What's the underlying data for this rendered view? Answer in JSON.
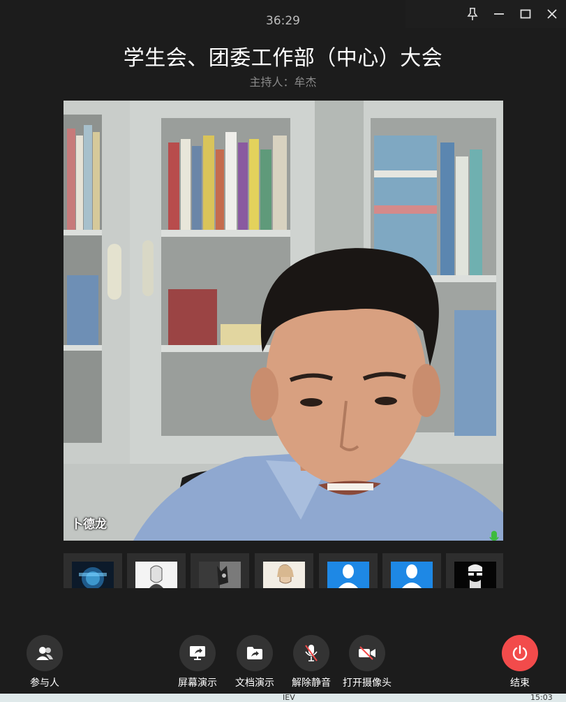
{
  "meeting": {
    "timer": "36:29",
    "title": "学生会、团委工作部（中心）大会",
    "host": "主持人：牟杰"
  },
  "main_video": {
    "speaker_name": "卜德龙"
  },
  "window_controls": {
    "icons": [
      "pin-icon",
      "minimize-icon",
      "maximize-icon",
      "close-icon"
    ]
  },
  "participant_thumbnails": [
    {
      "type": "image",
      "tone": "#1a3a5a"
    },
    {
      "type": "image",
      "tone": "#f4f4f4"
    },
    {
      "type": "image",
      "tone": "#6a6a6a"
    },
    {
      "type": "image",
      "tone": "#f1ebe2"
    },
    {
      "type": "default-avatar",
      "tone": "#1e88e5"
    },
    {
      "type": "default-avatar",
      "tone": "#1e88e5"
    },
    {
      "type": "image",
      "tone": "#050505"
    }
  ],
  "controls": {
    "participants": "参与人",
    "screen_share": "屏幕演示",
    "doc_share": "文档演示",
    "unmute": "解除静音",
    "camera_on": "打开摄像头",
    "end": "结束"
  },
  "colors": {
    "background": "#1c1c1c",
    "control_circle": "#333333",
    "end_button": "#f24b4b",
    "avatar_blue": "#1e88e5",
    "mic_green": "#3dbb3d"
  },
  "taskbar": {
    "partial_text_1": "IEV",
    "partial_clock": "15:03"
  }
}
